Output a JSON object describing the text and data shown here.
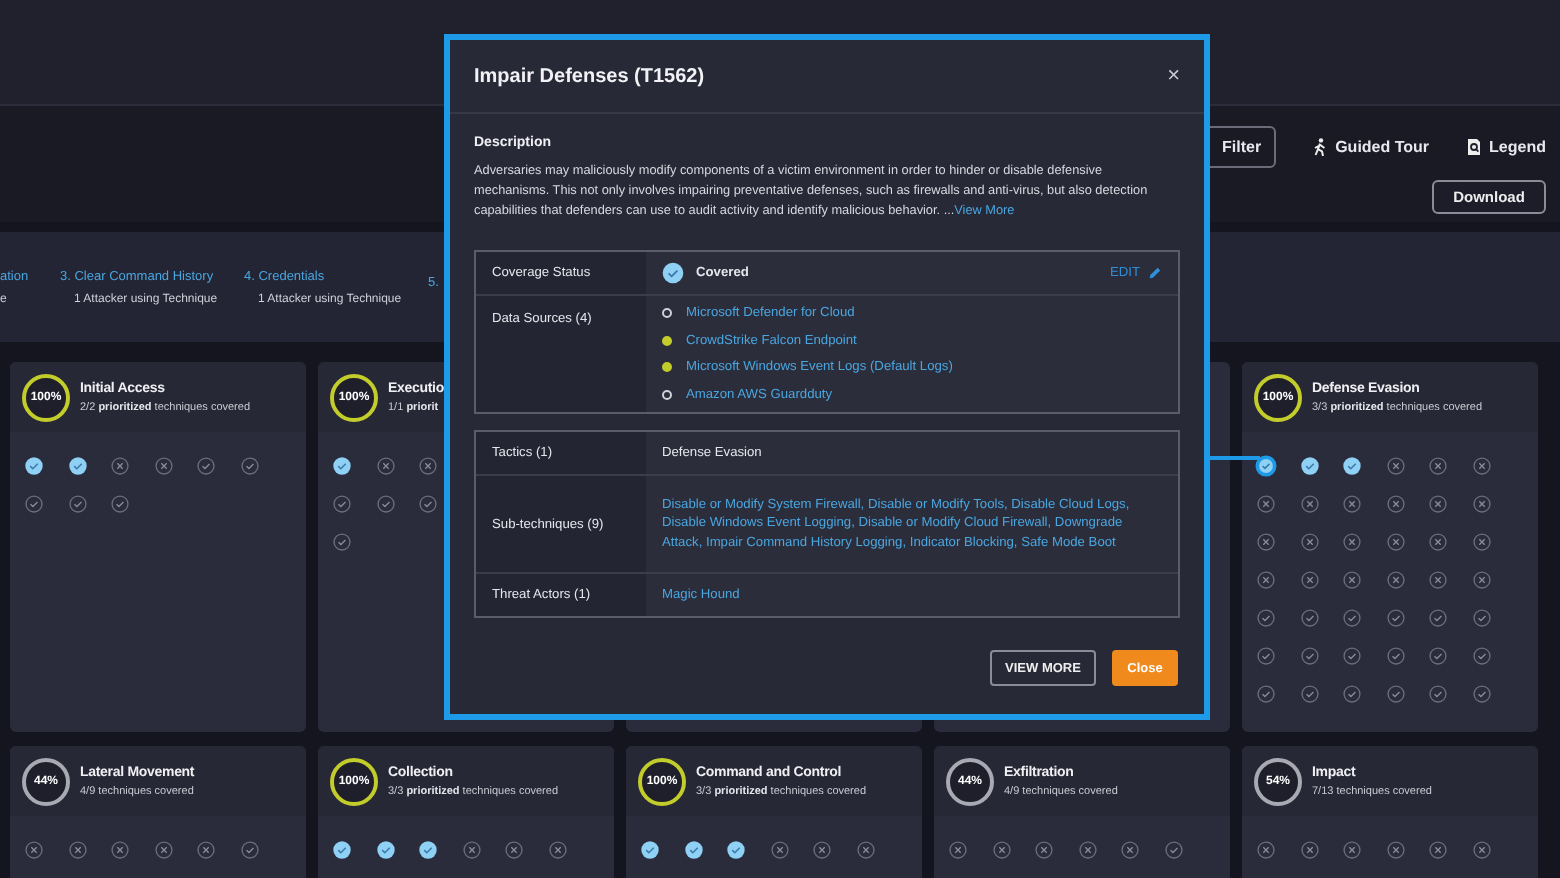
{
  "toolbar": {
    "filter": "Filter",
    "guided_tour": "Guided Tour",
    "legend": "Legend",
    "download": "Download"
  },
  "attack_path": [
    {
      "title": "ation",
      "sub": "e"
    },
    {
      "title": "3. Clear Command History",
      "sub": "1 Attacker using Technique"
    },
    {
      "title": "4. Credentials",
      "sub": "1 Attacker using Technique"
    },
    {
      "title": "5."
    }
  ],
  "top_cards": [
    {
      "percent": "100%",
      "complete": true,
      "title": "Initial Access",
      "subtitle": "2/2 **prioritized** techniques covered",
      "rows": [
        [
          {
            "kind": "covered"
          },
          {
            "kind": "covered"
          },
          {
            "kind": "missed"
          },
          {
            "kind": "missed"
          },
          {
            "kind": "checked"
          },
          {
            "kind": "checked"
          }
        ],
        [
          {
            "kind": "checked"
          },
          {
            "kind": "checked"
          },
          {
            "kind": "checked"
          }
        ]
      ]
    },
    {
      "percent": "100%",
      "complete": true,
      "title": "Executio",
      "subtitle": "1/1 **priorit**",
      "rows": [
        [
          {
            "kind": "covered"
          },
          {
            "kind": "missed"
          },
          {
            "kind": "missed"
          }
        ],
        [
          {
            "kind": "checked"
          },
          {
            "kind": "checked"
          },
          {
            "kind": "checked"
          }
        ],
        [
          {
            "kind": "checked"
          }
        ]
      ]
    },
    {
      "percent": "100%",
      "complete": true,
      "title": "Defense Evasion",
      "subtitle": "3/3 **prioritized** techniques covered",
      "rows": [
        [
          {
            "kind": "active"
          },
          {
            "kind": "covered"
          },
          {
            "kind": "covered"
          },
          {
            "kind": "missed"
          },
          {
            "kind": "missed"
          },
          {
            "kind": "missed"
          }
        ],
        [
          {
            "kind": "missed"
          },
          {
            "kind": "missed"
          },
          {
            "kind": "missed"
          },
          {
            "kind": "missed"
          },
          {
            "kind": "missed"
          },
          {
            "kind": "missed"
          }
        ],
        [
          {
            "kind": "missed"
          },
          {
            "kind": "missed"
          },
          {
            "kind": "missed"
          },
          {
            "kind": "missed"
          },
          {
            "kind": "missed"
          },
          {
            "kind": "missed"
          }
        ],
        [
          {
            "kind": "missed"
          },
          {
            "kind": "missed"
          },
          {
            "kind": "missed"
          },
          {
            "kind": "missed"
          },
          {
            "kind": "missed"
          },
          {
            "kind": "missed"
          }
        ],
        [
          {
            "kind": "checked"
          },
          {
            "kind": "checked"
          },
          {
            "kind": "checked"
          },
          {
            "kind": "checked"
          },
          {
            "kind": "checked"
          },
          {
            "kind": "checked"
          }
        ],
        [
          {
            "kind": "checked"
          },
          {
            "kind": "checked"
          },
          {
            "kind": "checked"
          },
          {
            "kind": "checked"
          },
          {
            "kind": "checked"
          },
          {
            "kind": "checked"
          }
        ],
        [
          {
            "kind": "checked"
          },
          {
            "kind": "checked"
          },
          {
            "kind": "checked"
          },
          {
            "kind": "checked"
          },
          {
            "kind": "checked"
          },
          {
            "kind": "checked"
          }
        ]
      ]
    }
  ],
  "bottom_cards": [
    {
      "percent": "44%",
      "complete": false,
      "title": "Lateral Movement",
      "subtitle": "4/9 techniques covered",
      "rows": [
        [
          {
            "kind": "missed"
          },
          {
            "kind": "missed"
          },
          {
            "kind": "missed"
          },
          {
            "kind": "missed"
          },
          {
            "kind": "missed"
          },
          {
            "kind": "checked"
          }
        ]
      ]
    },
    {
      "percent": "100%",
      "complete": true,
      "title": "Collection",
      "subtitle": "3/3 **prioritized** techniques covered",
      "rows": [
        [
          {
            "kind": "covered"
          },
          {
            "kind": "covered"
          },
          {
            "kind": "covered"
          },
          {
            "kind": "missed"
          },
          {
            "kind": "missed"
          },
          {
            "kind": "missed"
          }
        ]
      ]
    },
    {
      "percent": "100%",
      "complete": true,
      "title": "Command and Control",
      "subtitle": "3/3 **prioritized** techniques covered",
      "rows": [
        [
          {
            "kind": "covered"
          },
          {
            "kind": "covered"
          },
          {
            "kind": "covered"
          },
          {
            "kind": "missed"
          },
          {
            "kind": "missed"
          },
          {
            "kind": "missed"
          }
        ]
      ]
    },
    {
      "percent": "44%",
      "complete": false,
      "title": "Exfiltration",
      "subtitle": "4/9 techniques covered",
      "rows": [
        [
          {
            "kind": "missed"
          },
          {
            "kind": "missed"
          },
          {
            "kind": "missed"
          },
          {
            "kind": "missed"
          },
          {
            "kind": "missed"
          },
          {
            "kind": "checked"
          }
        ]
      ]
    },
    {
      "percent": "54%",
      "complete": false,
      "title": "Impact",
      "subtitle": "7/13 techniques covered",
      "rows": [
        [
          {
            "kind": "missed"
          },
          {
            "kind": "missed"
          },
          {
            "kind": "missed"
          },
          {
            "kind": "missed"
          },
          {
            "kind": "missed"
          },
          {
            "kind": "missed"
          }
        ]
      ]
    }
  ],
  "modal": {
    "title": "Impair Defenses (T1562)",
    "close": "×",
    "description_heading": "Description",
    "description": "Adversaries may maliciously modify components of a victim environment in order to hinder or disable defensive mechanisms. This not only involves impairing preventative defenses, such as firewalls and anti-virus, but also detection capabilities that defenders can use to audit activity and identify malicious behavior. ...",
    "view_more_link": "View More",
    "coverage_label": "Coverage Status",
    "coverage_value": "Covered",
    "edit": "EDIT",
    "data_sources_label": "Data Sources (4)",
    "data_sources": [
      {
        "name": "Microsoft Defender for Cloud",
        "active": false
      },
      {
        "name": "CrowdStrike Falcon Endpoint",
        "active": true
      },
      {
        "name": "Microsoft Windows Event Logs (Default Logs)",
        "active": true
      },
      {
        "name": "Amazon AWS Guardduty",
        "active": false
      }
    ],
    "tactics_label": "Tactics (1)",
    "tactics_value": "Defense Evasion",
    "subtechniques_label": "Sub-techniques (9)",
    "subtechniques_value": "Disable or Modify System Firewall, Disable or Modify Tools, Disable Cloud Logs, Disable Windows Event Logging, Disable or Modify Cloud Firewall, Downgrade Attack, Impair Command History Logging, Indicator Blocking, Safe Mode Boot",
    "threat_actors_label": "Threat Actors (1)",
    "threat_actors_value": "Magic Hound",
    "view_more_button": "VIEW MORE",
    "close_button": "Close"
  }
}
